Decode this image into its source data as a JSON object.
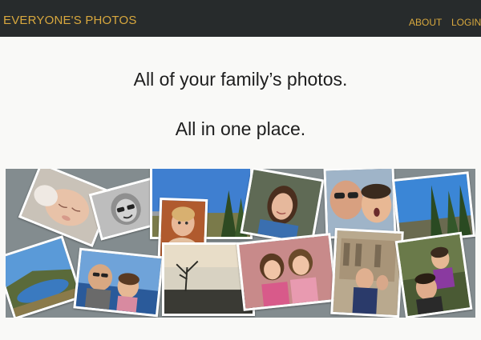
{
  "navbar": {
    "brand": "EVERYONE'S PHOTOS",
    "links": {
      "about": "ABOUT",
      "login": "LOGIN"
    }
  },
  "hero": {
    "line1": "All of your family’s photos.",
    "line2": "All in one place."
  },
  "colors": {
    "navbar_bg": "#272b2c",
    "accent": "#d8a83e",
    "page_bg": "#f9f9f7",
    "collage_bg": "#838c8f"
  },
  "collage": {
    "photos": [
      {
        "name": "photo-baby-sleeping"
      },
      {
        "name": "photo-woman-bw-sunglasses"
      },
      {
        "name": "photo-blue-sky-trees"
      },
      {
        "name": "photo-toddler-vintage"
      },
      {
        "name": "photo-woman-smiling-portrait"
      },
      {
        "name": "photo-couple-sunglasses-selfie"
      },
      {
        "name": "photo-forest-blue-sky"
      },
      {
        "name": "photo-lake-landscape"
      },
      {
        "name": "photo-couple-on-water"
      },
      {
        "name": "photo-misty-tree-sunset"
      },
      {
        "name": "photo-two-girls"
      },
      {
        "name": "photo-family-selfie-building"
      },
      {
        "name": "photo-women-smiling-outdoors"
      }
    ]
  }
}
